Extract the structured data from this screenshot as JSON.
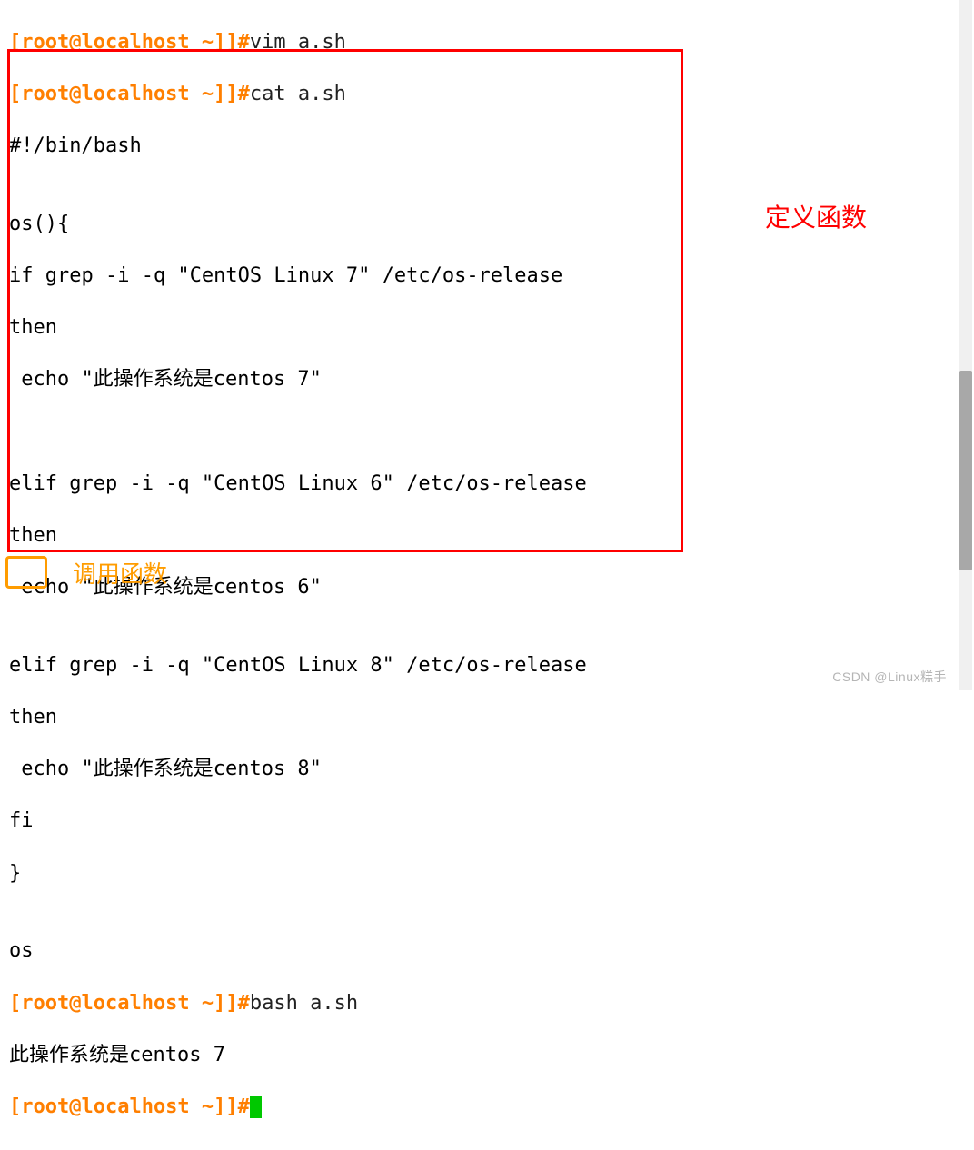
{
  "prompt": {
    "text": "[root@localhost ~]]#"
  },
  "commands": {
    "vim": "vim a.sh",
    "cat": "cat a.sh",
    "bash": "bash a.sh",
    "empty": ""
  },
  "script": {
    "l01": "#!/bin/bash",
    "l02": "",
    "l03": "os(){",
    "l04": "if grep -i -q \"CentOS Linux 7\" /etc/os-release",
    "l05": "then",
    "l06": " echo \"此操作系统是centos 7\"",
    "l07": "",
    "l08": "",
    "l09": "elif grep -i -q \"CentOS Linux 6\" /etc/os-release",
    "l10": "then",
    "l11": " echo \"此操作系统是centos 6\"",
    "l12": "",
    "l13": "elif grep -i -q \"CentOS Linux 8\" /etc/os-release",
    "l14": "then",
    "l15": " echo \"此操作系统是centos 8\"",
    "l16": "fi",
    "l17": "}",
    "l18": "",
    "l19": "os"
  },
  "output": {
    "result": "此操作系统是centos 7"
  },
  "annotations": {
    "define_function": "定义函数",
    "call_function": "调用函数"
  },
  "watermark": "CSDN @Linux糕手"
}
